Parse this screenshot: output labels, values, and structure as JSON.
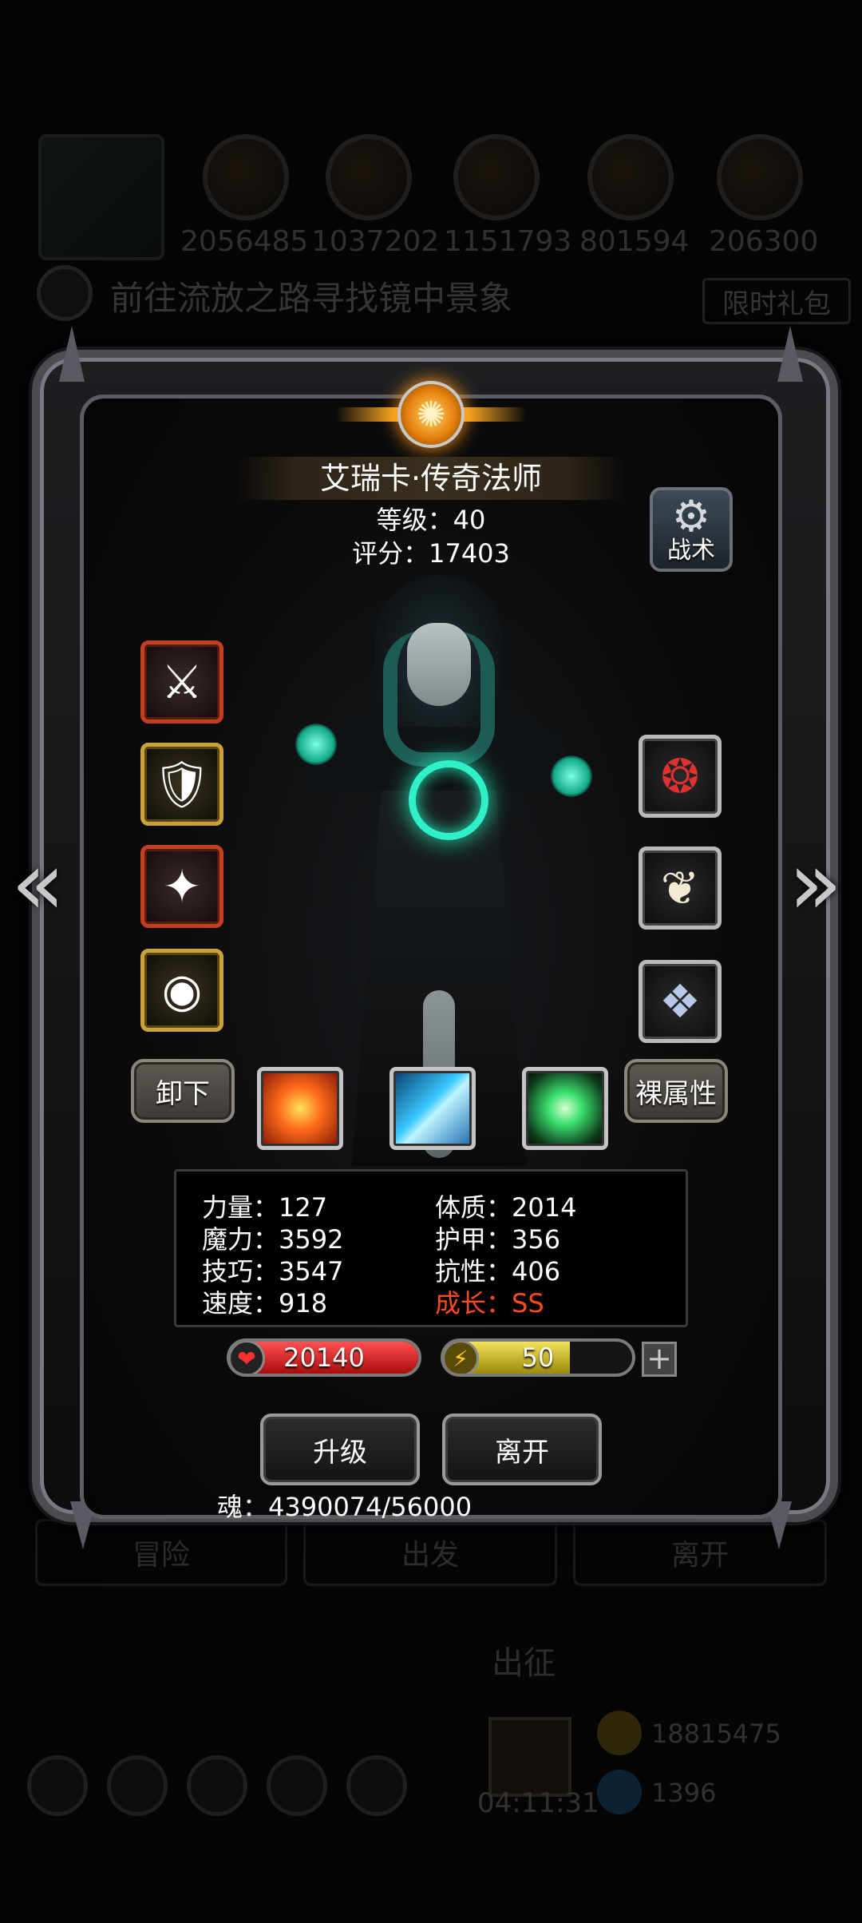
{
  "background": {
    "resources": [
      "2056485",
      "1037202",
      "1151793",
      "801594",
      "206300"
    ],
    "quest_text": "前往流放之路寻找镜中景象",
    "gift_label": "限时礼包",
    "tabs": [
      "冒险",
      "出发",
      "离开"
    ],
    "sortie_label": "出征",
    "timer": "04:11:31",
    "coins": [
      "18815475",
      "1396"
    ]
  },
  "hero": {
    "name": "艾瑞卡·传奇法师",
    "level_text": "等级：40",
    "score_text": "评分：17403"
  },
  "tactics_label": "战术",
  "equipment": {
    "left": [
      {
        "name": "scythe-icon",
        "glyph": "⚔",
        "rarity": "red"
      },
      {
        "name": "armor-icon",
        "glyph": "🛡",
        "rarity": "gold"
      },
      {
        "name": "amulet-icon",
        "glyph": "✦",
        "rarity": "red"
      },
      {
        "name": "eye-charm-icon",
        "glyph": "◉",
        "rarity": "gold"
      }
    ],
    "right": [
      {
        "name": "red-orb-icon",
        "glyph": "❂",
        "rarity": "white"
      },
      {
        "name": "feather-icon",
        "glyph": "❦",
        "rarity": "white"
      },
      {
        "name": "crystal-badge-icon",
        "glyph": "❖",
        "rarity": "white"
      }
    ]
  },
  "buttons": {
    "unequip": "卸下",
    "base_attr": "裸属性",
    "upgrade": "升级",
    "leave": "离开"
  },
  "skills": [
    {
      "name": "fire-skill-icon",
      "color": "#ff6a1a"
    },
    {
      "name": "ice-skill-icon",
      "color": "#38c8ff"
    },
    {
      "name": "nature-skill-icon",
      "color": "#3ce070"
    }
  ],
  "stats": {
    "strength": "力量：127",
    "magic": "魔力：3592",
    "skill": "技巧：3547",
    "speed": "速度：918",
    "constitution": "体质：2014",
    "armor": "护甲：356",
    "resistance": "抗性：406",
    "growth": "成长：SS"
  },
  "bars": {
    "hp": "20140",
    "hp_fill": 1.0,
    "energy": "50",
    "energy_fill": 0.67
  },
  "soul_text": "魂：4390074/56000",
  "colors": {
    "growth": "#ff4a1c",
    "hp": "#d71f1f",
    "energy": "#d9c21a"
  }
}
